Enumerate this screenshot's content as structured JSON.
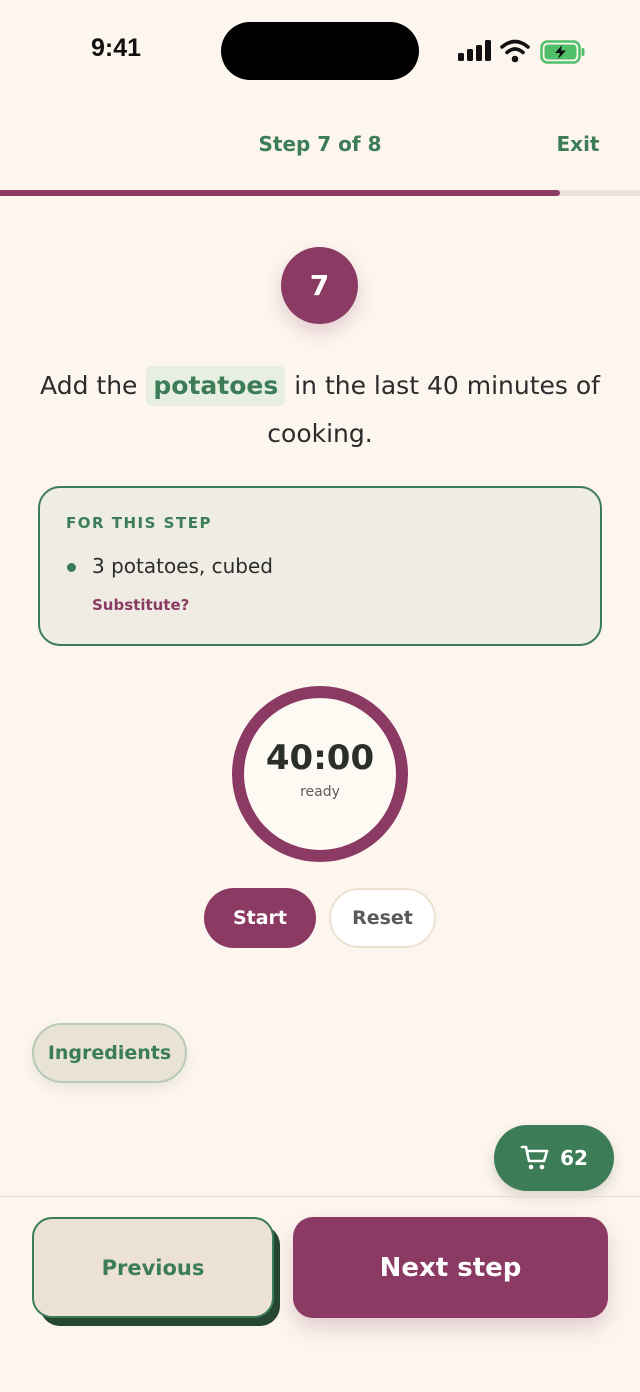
{
  "status_bar": {
    "time": "9:41",
    "icons": [
      "cellular-signal-icon",
      "wifi-icon",
      "battery-charging-icon"
    ]
  },
  "header": {
    "step_label": "Step 7 of 8",
    "exit_label": "Exit",
    "progress_fraction": 0.875
  },
  "step": {
    "number": "7",
    "instruction_before": "Add the",
    "instruction_highlight": "potatoes",
    "instruction_after": "in the last 40 minutes of cooking."
  },
  "step_card": {
    "heading": "FOR THIS STEP",
    "items": [
      {
        "text": "3 potatoes, cubed",
        "substitute_label": "Substitute?"
      }
    ]
  },
  "timer": {
    "time": "40:00",
    "status": "ready",
    "start_label": "Start",
    "reset_label": "Reset"
  },
  "ingredients_button": {
    "label": "Ingredients"
  },
  "cart": {
    "count": "62",
    "icon": "shopping-cart-icon"
  },
  "footer": {
    "previous_label": "Previous",
    "next_label": "Next step"
  },
  "colors": {
    "background": "#fcf6ee",
    "primary_plum": "#8b3a64",
    "accent_green": "#3c7d57",
    "card_background": "#efede3"
  }
}
